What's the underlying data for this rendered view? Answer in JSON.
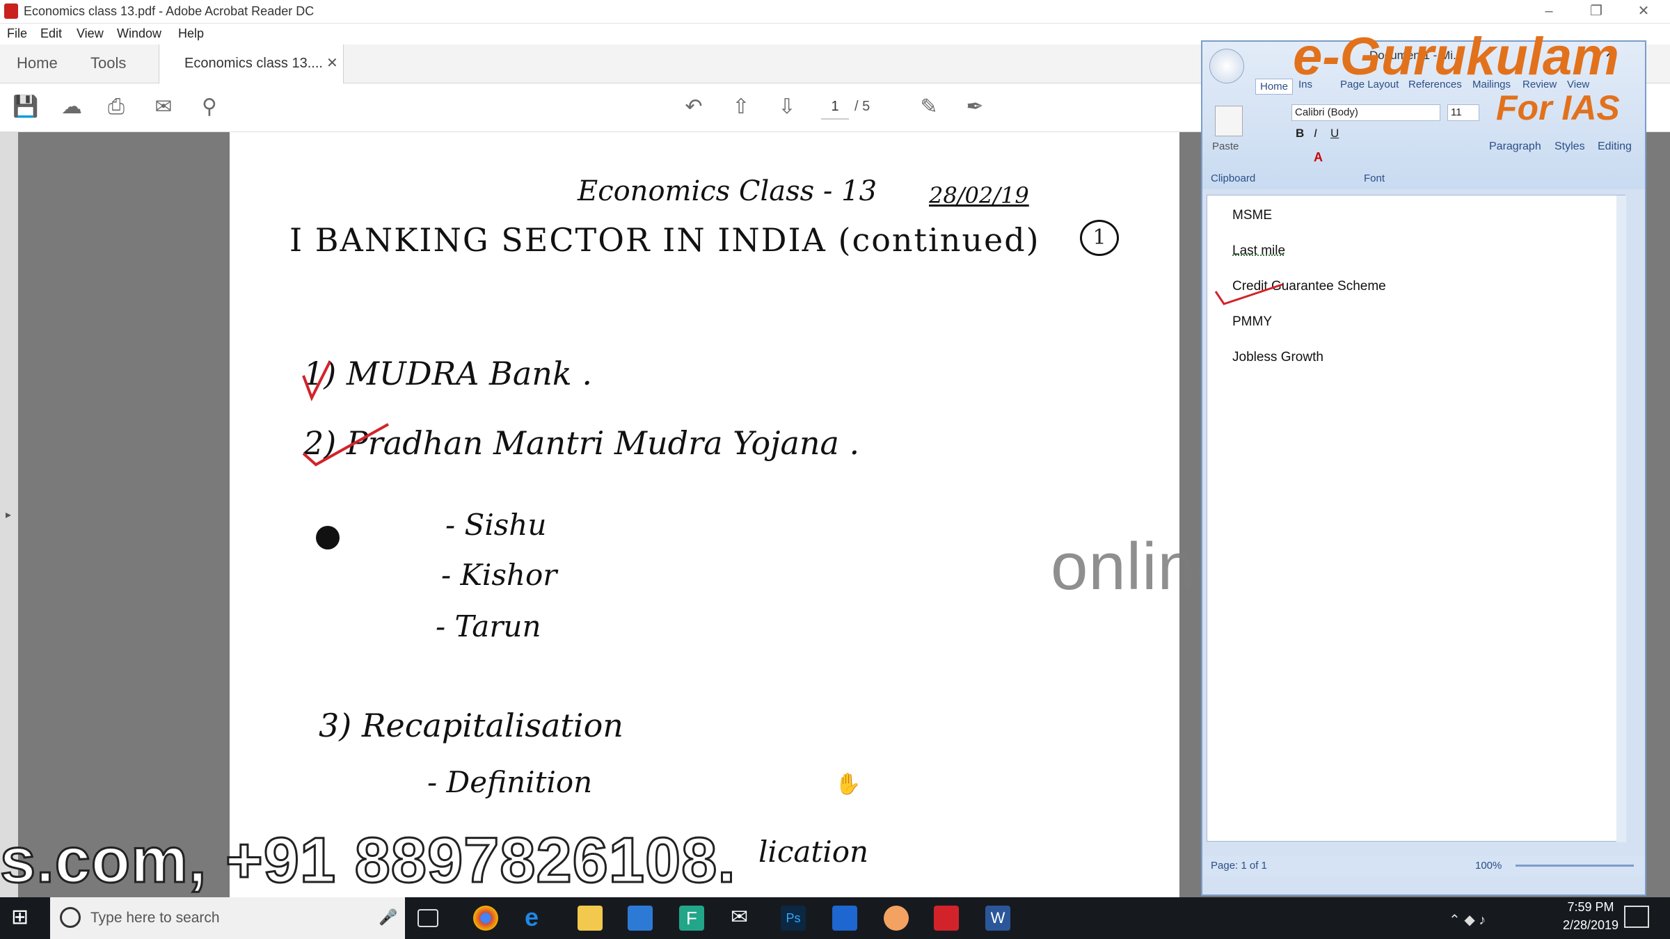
{
  "acrobat": {
    "title": "Economics class 13.pdf - Adobe Acrobat Reader DC",
    "menu": [
      "File",
      "Edit",
      "View",
      "Window",
      "Help"
    ],
    "tab_home": "Home",
    "tab_tools": "Tools",
    "tab_doc": "Economics class 13....",
    "page_current": "1",
    "page_total": "/ 5"
  },
  "notes": {
    "heading": "Economics Class - 13",
    "date": "28/02/19",
    "circle_number": "1",
    "topic": "I   BANKING SECTOR IN INDIA (continued)",
    "item1": "1)  MUDRA Bank .",
    "item2": "2)  Pradhan Mantri Mudra Yojana .",
    "sub1": "- Sishu",
    "sub2": "- Kishor",
    "sub3": "- Tarun",
    "item3": "3)  Recapitalisation",
    "sub4": "- Definition",
    "cut": "lication"
  },
  "overlay": {
    "watermark": "online-ias.com",
    "phone": "s.com, +91 8897826108.",
    "brand": "e-Gurukulam",
    "brand_sub": "For IAS"
  },
  "word": {
    "title": "Document1 - Mi...",
    "tabs": [
      "Home",
      "Ins",
      "Page Layout",
      "References",
      "Mailings",
      "Review",
      "View"
    ],
    "font_name": "Calibri (Body)",
    "font_size": "11",
    "paste": "Paste",
    "clipboard": "Clipboard",
    "font_group": "Font",
    "paragraph": "Paragraph",
    "styles": "Styles",
    "editing": "Editing",
    "lines": [
      "MSME",
      "Last mile",
      "Credit Guarantee Scheme",
      "PMMY",
      "Jobless Growth"
    ],
    "page_status": "Page: 1 of 1",
    "zoom": "100%"
  },
  "taskbar": {
    "search_placeholder": "Type here to search",
    "time": "7:59 PM",
    "date": "2/28/2019"
  }
}
